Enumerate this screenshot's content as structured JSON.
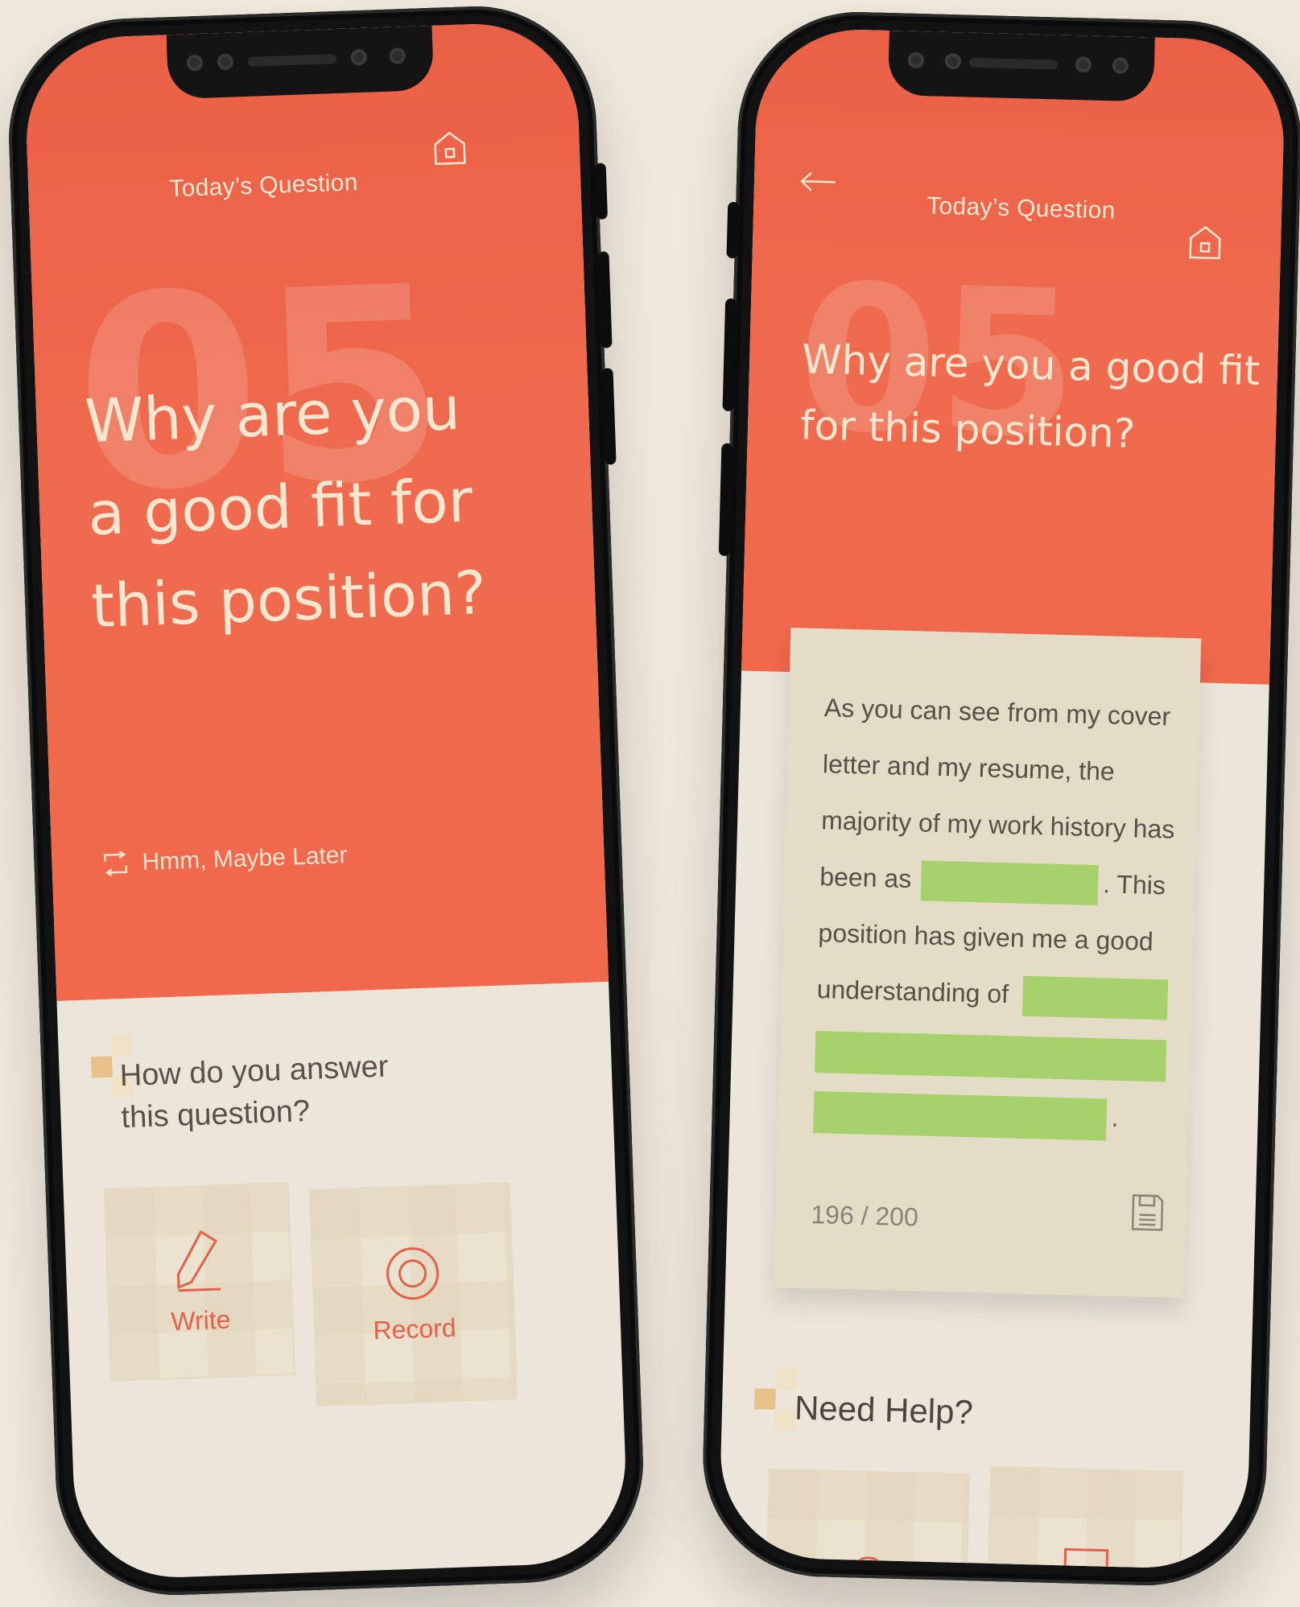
{
  "left_screen": {
    "title": "Today’s Question",
    "question_number": "05",
    "question": "Why are you a good fit for this position?",
    "question_lines": [
      "Why are you",
      "a good fit for",
      "this position?"
    ],
    "skip_label": "Hmm, Maybe Later",
    "prompt": "How do you answer this question?",
    "prompt_lines": [
      "How do you answer",
      "this question?"
    ],
    "options": [
      {
        "label": "Write",
        "icon": "pencil-icon"
      },
      {
        "label": "Record",
        "icon": "record-icon"
      }
    ]
  },
  "right_screen": {
    "title": "Today’s Question",
    "question_number": "05",
    "question": "Why are you a good fit for this position?",
    "question_lines": [
      "Why are you a good fit",
      "for this position?"
    ],
    "answer_lines": [
      "As you can see from my cover",
      "letter and my resume, the",
      "majority of my work history has",
      "been as",
      ". This",
      "position has given me a good",
      "understanding of",
      "."
    ],
    "char_count": "196 / 200",
    "help_title": "Need Help?"
  },
  "colors": {
    "accent": "#ef6a4e",
    "highlight": "#a7d16b",
    "background": "#efe9dc",
    "deco": "#e7c08a"
  }
}
